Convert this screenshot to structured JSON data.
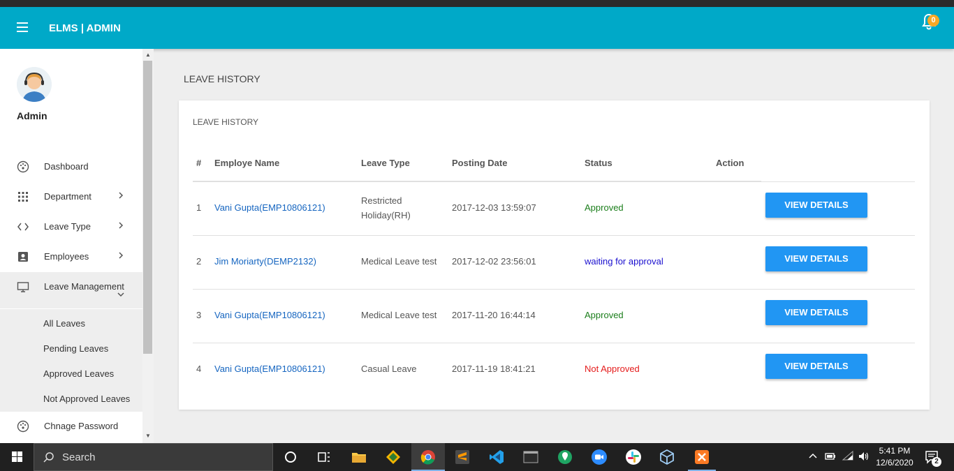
{
  "app": {
    "brand": "ELMS | ADMIN",
    "notification_count": "0"
  },
  "sidebar": {
    "user_name": "Admin",
    "items": [
      {
        "label": "Dashboard"
      },
      {
        "label": "Department"
      },
      {
        "label": "Leave Type"
      },
      {
        "label": "Employees"
      },
      {
        "label": "Leave Management"
      },
      {
        "label": "Chnage Password"
      }
    ],
    "sub_items": [
      {
        "label": "All Leaves"
      },
      {
        "label": "Pending Leaves"
      },
      {
        "label": "Approved Leaves"
      },
      {
        "label": "Not Approved Leaves"
      }
    ]
  },
  "page": {
    "title": "LEAVE HISTORY",
    "card_title": "LEAVE HISTORY"
  },
  "table": {
    "headers": [
      "#",
      "Employe Name",
      "Leave Type",
      "Posting Date",
      "Status",
      "Action"
    ],
    "rows": [
      {
        "num": "1",
        "name": "Vani Gupta(EMP10806121)",
        "leave_type": "Restricted Holiday(RH)",
        "date": "2017-12-03 13:59:07",
        "status": "Approved",
        "status_color": "#1b7e1b",
        "action": "VIEW DETAILS"
      },
      {
        "num": "2",
        "name": "Jim Moriarty(DEMP2132)",
        "leave_type": "Medical Leave test",
        "date": "2017-12-02 23:56:01",
        "status": "waiting for approval",
        "status_color": "#1a0fcf",
        "action": "VIEW DETAILS"
      },
      {
        "num": "3",
        "name": "Vani Gupta(EMP10806121)",
        "leave_type": "Medical Leave test",
        "date": "2017-11-20 16:44:14",
        "status": "Approved",
        "status_color": "#1b7e1b",
        "action": "VIEW DETAILS"
      },
      {
        "num": "4",
        "name": "Vani Gupta(EMP10806121)",
        "leave_type": "Casual Leave",
        "date": "2017-11-19 18:41:21",
        "status": "Not Approved",
        "status_color": "#e51c1c",
        "action": "VIEW DETAILS"
      }
    ]
  },
  "taskbar": {
    "search_placeholder": "Search",
    "time": "5:41 PM",
    "date": "12/6/2020",
    "notification_count": "2"
  },
  "colors": {
    "header": "#00a9c8",
    "button": "#2196f3"
  }
}
